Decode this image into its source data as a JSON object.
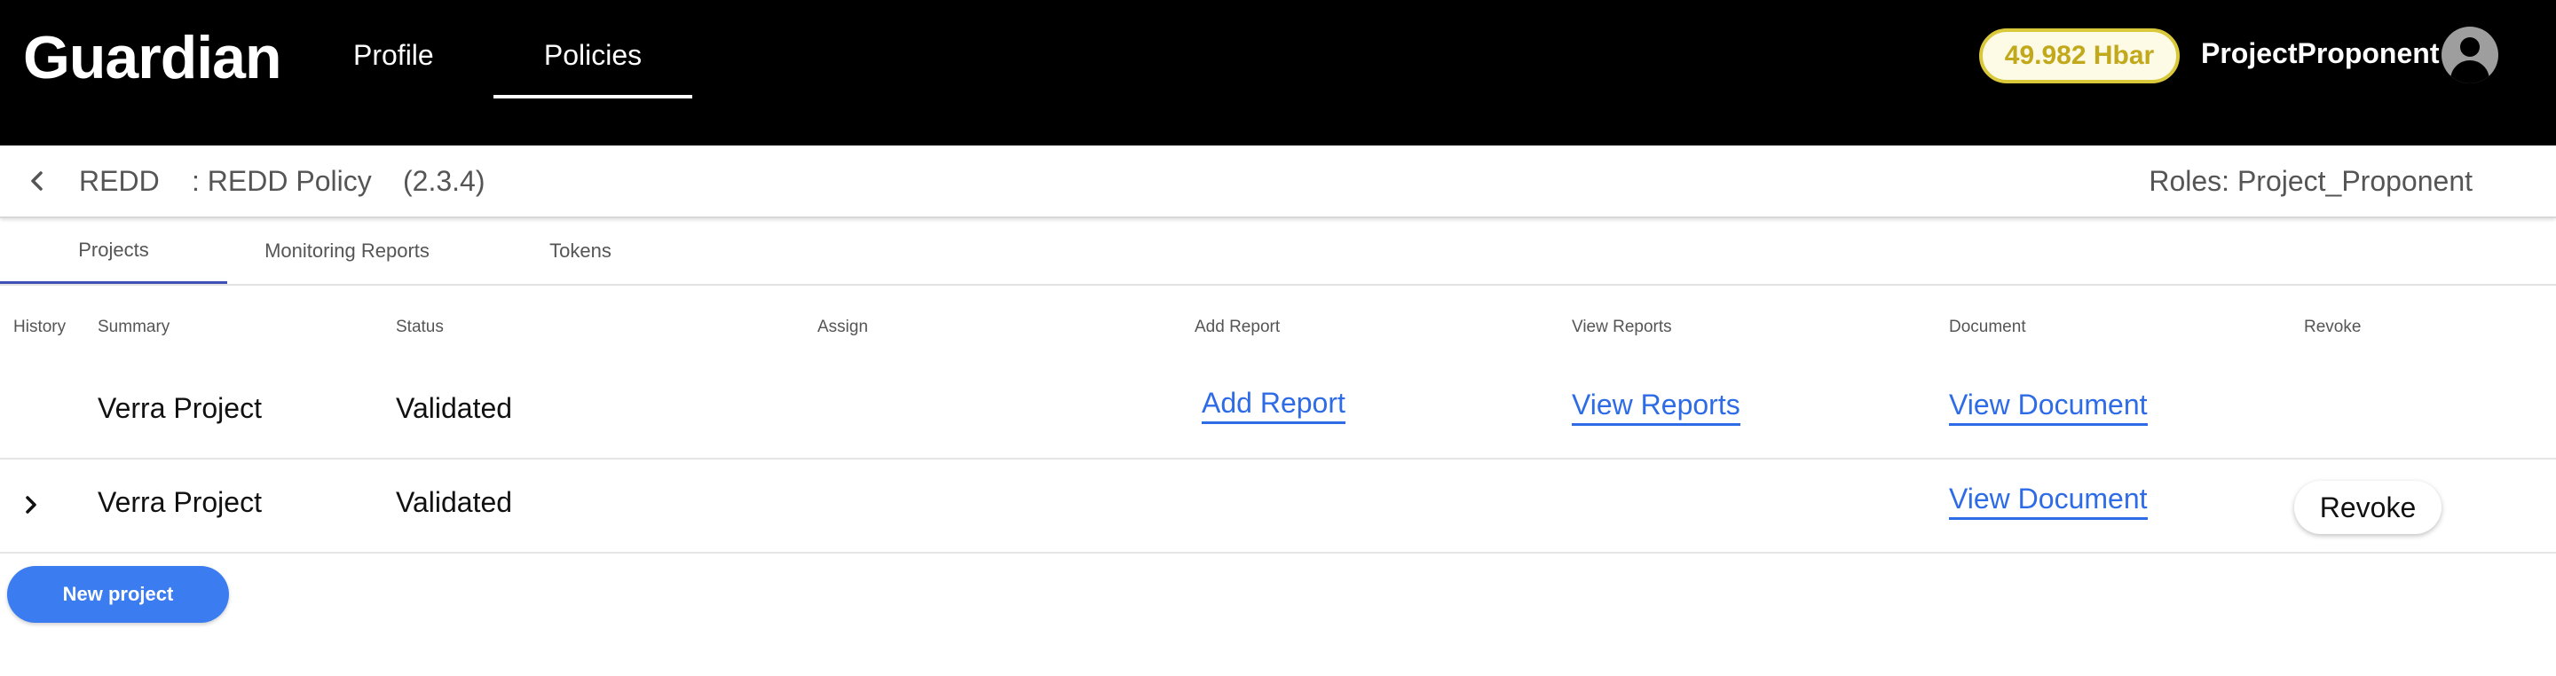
{
  "header": {
    "logo": "Guardian",
    "nav": [
      {
        "label": "Profile"
      },
      {
        "label": "Policies",
        "active": true
      }
    ],
    "balance": "49.982 Hbar",
    "username": "ProjectProponent",
    "avatar_icon": "account-circle-icon"
  },
  "policy": {
    "name": "REDD",
    "description": ": REDD Policy",
    "version": "(2.3.4)",
    "roles": "Roles: Project_Proponent",
    "back_icon": "chevron-left-icon"
  },
  "tabs": [
    {
      "label": "Projects",
      "active": true
    },
    {
      "label": "Monitoring Reports"
    },
    {
      "label": "Tokens"
    }
  ],
  "table": {
    "columns": [
      "History",
      "Summary",
      "Status",
      "Assign",
      "Add Report",
      "View Reports",
      "Document",
      "Revoke"
    ],
    "rows": [
      {
        "summary": "Verra Project",
        "status": "Validated",
        "add_report": "Add Report",
        "view_reports": "View Reports",
        "document": "View Document"
      },
      {
        "summary": "Verra Project",
        "status": "Validated",
        "document": "View Document",
        "revoke": "Revoke",
        "history_icon": "chevron-right-icon"
      }
    ]
  },
  "actions": {
    "new_project": "New project"
  },
  "colors": {
    "header_bg": "#000000",
    "balance_text": "#c2a91b",
    "balance_border": "#d9c83a",
    "link": "#2e6be6",
    "primary_button": "#3b7cf0",
    "tab_indicator": "#3f51b5"
  }
}
